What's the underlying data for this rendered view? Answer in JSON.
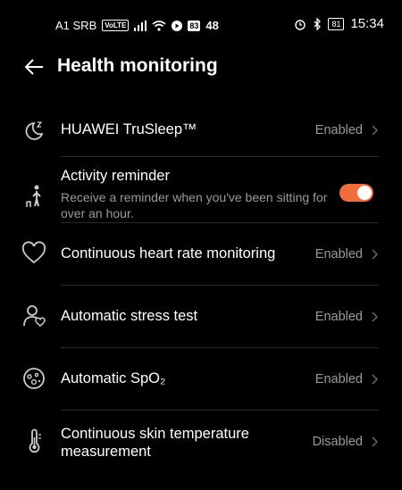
{
  "status": {
    "carrier": "A1 SRB",
    "volte": "VoLTE",
    "box_number": "83",
    "net_number": "48",
    "battery": "81",
    "time": "15:34"
  },
  "header": {
    "title": "Health monitoring"
  },
  "settings": [
    {
      "label": "HUAWEI TruSleep™",
      "value": "Enabled",
      "icon": "sleep-icon"
    },
    {
      "label": "Activity reminder",
      "description": "Receive a reminder when you've been sitting for over an hour.",
      "toggle": true,
      "icon": "activity-icon"
    },
    {
      "label": "Continuous heart rate monitoring",
      "value": "Enabled",
      "icon": "heart-icon"
    },
    {
      "label": "Automatic stress test",
      "value": "Enabled",
      "icon": "stress-icon"
    },
    {
      "label": "Automatic SpO₂",
      "value": "Enabled",
      "icon": "spo2-icon"
    },
    {
      "label": "Continuous skin temperature measurement",
      "value": "Disabled",
      "icon": "thermometer-icon"
    }
  ],
  "colors": {
    "accent": "#f26b3a",
    "secondary_text": "#9a9a9a"
  }
}
